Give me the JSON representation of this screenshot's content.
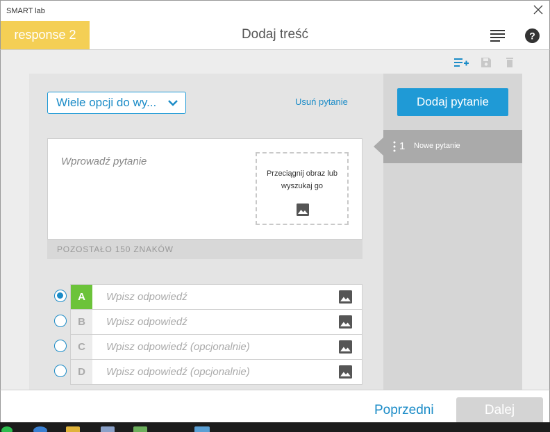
{
  "window": {
    "title": "SMART lab"
  },
  "header": {
    "response_tab": "response 2",
    "page_title": "Dodaj treść"
  },
  "editor": {
    "question_type": "Wiele opcji do wy...",
    "remove_question": "Usuń pytanie",
    "question_placeholder": "Wprowadź pytanie",
    "dropzone_text": "Przeciągnij obraz lub wyszukaj go",
    "chars_remaining": "POZOSTAŁO 150 ZNAKÓW",
    "answers": [
      {
        "letter": "A",
        "placeholder": "Wpisz odpowiedź",
        "selected": true
      },
      {
        "letter": "B",
        "placeholder": "Wpisz odpowiedź",
        "selected": false
      },
      {
        "letter": "C",
        "placeholder": "Wpisz odpowiedź (opcjonalnie)",
        "selected": false
      },
      {
        "letter": "D",
        "placeholder": "Wpisz odpowiedź (opcjonalnie)",
        "selected": false
      }
    ]
  },
  "sidepanel": {
    "add_question": "Dodaj pytanie",
    "questions": [
      {
        "number": "1",
        "label": "Nowe pytanie"
      }
    ]
  },
  "footer": {
    "previous": "Poprzedni",
    "next": "Dalej"
  },
  "colors": {
    "accent": "#1f9ad6",
    "response_tab": "#f4cf55",
    "correct_answer": "#6cc33a"
  }
}
